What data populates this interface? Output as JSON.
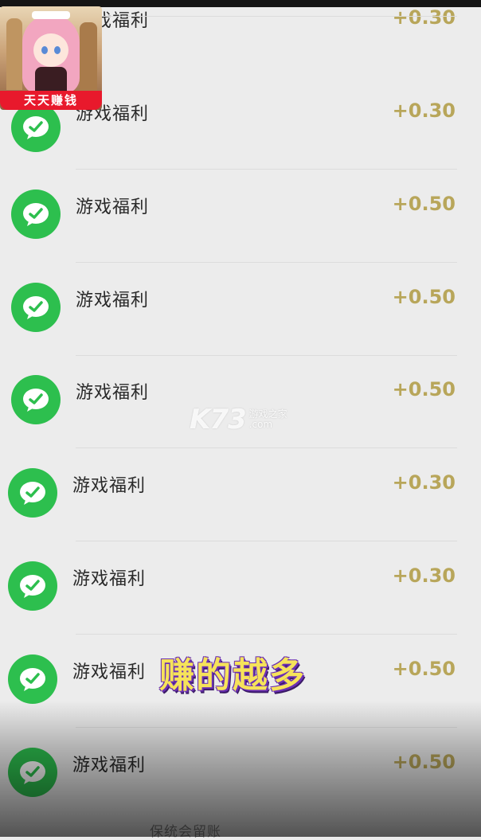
{
  "rows": [
    {
      "title": "游戏福利",
      "amount": "+0.30"
    },
    {
      "title": "游戏福利",
      "amount": "+0.30"
    },
    {
      "title": "游戏福利",
      "amount": "+0.50"
    },
    {
      "title": "游戏福利",
      "amount": "+0.50"
    },
    {
      "title": "游戏福利",
      "amount": "+0.50"
    },
    {
      "title": "游戏福利",
      "amount": "+0.30"
    },
    {
      "title": "游戏福利",
      "amount": "+0.30"
    },
    {
      "title": "游戏福利",
      "amount": "+0.50"
    },
    {
      "title": "游戏福利",
      "amount": "+0.50"
    }
  ],
  "thumbnail": {
    "banner": "天天赚钱"
  },
  "watermark": {
    "brand": "K73",
    "line1": "游戏之家",
    "line2": ".com"
  },
  "caption": "赚的越多",
  "footer_text": "保统会留账",
  "colors": {
    "wechat_green": "#2dbf4e",
    "amount_gold": "#b8a65a",
    "caption_yellow": "#f6e35a",
    "banner_red": "#e8192c"
  },
  "icons": {
    "row_icon": "wechat-icon"
  }
}
